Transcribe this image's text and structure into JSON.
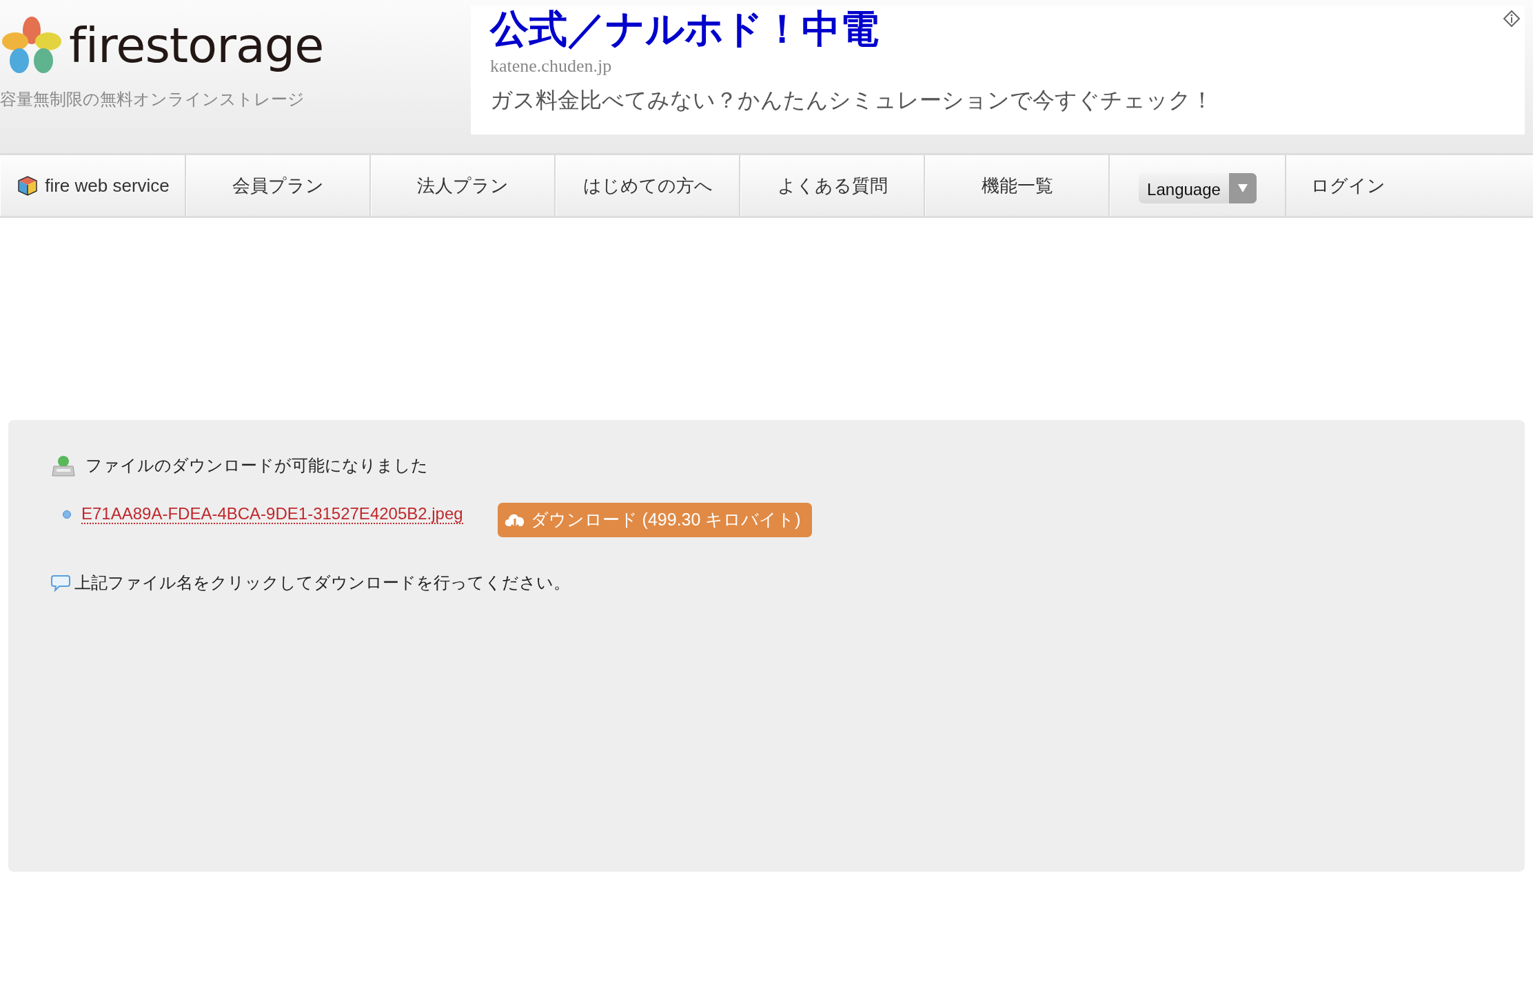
{
  "header": {
    "logo_text": "firestorage",
    "tagline": "容量無制限の無料オンラインストレージ"
  },
  "ad": {
    "title": "公式／ナルホド！中電",
    "url": "katene.chuden.jp",
    "description": "ガス料金比べてみない？かんたんシミュレーションで今すぐチェック！"
  },
  "nav": {
    "items": [
      {
        "label": "fire web service",
        "kind": "brand"
      },
      {
        "label": "会員プラン",
        "kind": "link"
      },
      {
        "label": "法人プラン",
        "kind": "link"
      },
      {
        "label": "はじめての方へ",
        "kind": "link"
      },
      {
        "label": "よくある質問",
        "kind": "link"
      },
      {
        "label": "機能一覧",
        "kind": "link"
      },
      {
        "label": "Language",
        "kind": "dropdown"
      },
      {
        "label": "ログイン",
        "kind": "plain"
      }
    ]
  },
  "download": {
    "heading": "ファイルのダウンロードが可能になりました",
    "file_name": "E71AA89A-FDEA-4BCA-9DE1-31527E4205B2.jpeg",
    "button_label": "ダウンロード (499.30 キロバイト)",
    "note": "上記ファイル名をクリックしてダウンロードを行ってください。"
  }
}
